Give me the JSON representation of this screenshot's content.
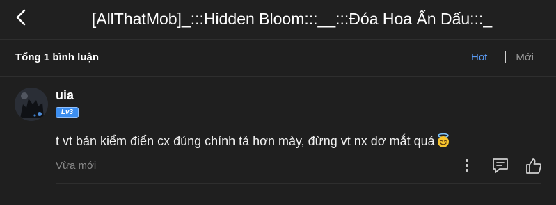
{
  "header": {
    "title": "[AllThatMob]_:::Hidden Bloom:::__:::Đóa Hoa Ẩn Dấu:::_",
    "back_icon": "chevron-left-icon"
  },
  "comments_bar": {
    "count_label": "Tổng 1 bình luận",
    "sort_tabs": [
      {
        "label": "Hot",
        "active": true
      },
      {
        "label": "Mới",
        "active": false
      }
    ]
  },
  "comments": [
    {
      "username": "uia",
      "level": "Lv3",
      "text": "t vt bản kiểm điển cx đúng chính tả hơn mày, đừng vt nx dơ mắt quá",
      "emoji": "smiling-face-with-halo",
      "time": "Vừa mới"
    }
  ],
  "colors": {
    "background": "#1f1f1f",
    "accent": "#5b9cf6",
    "level_badge": "#3c8ef0",
    "muted_text": "#8a8a8a"
  }
}
